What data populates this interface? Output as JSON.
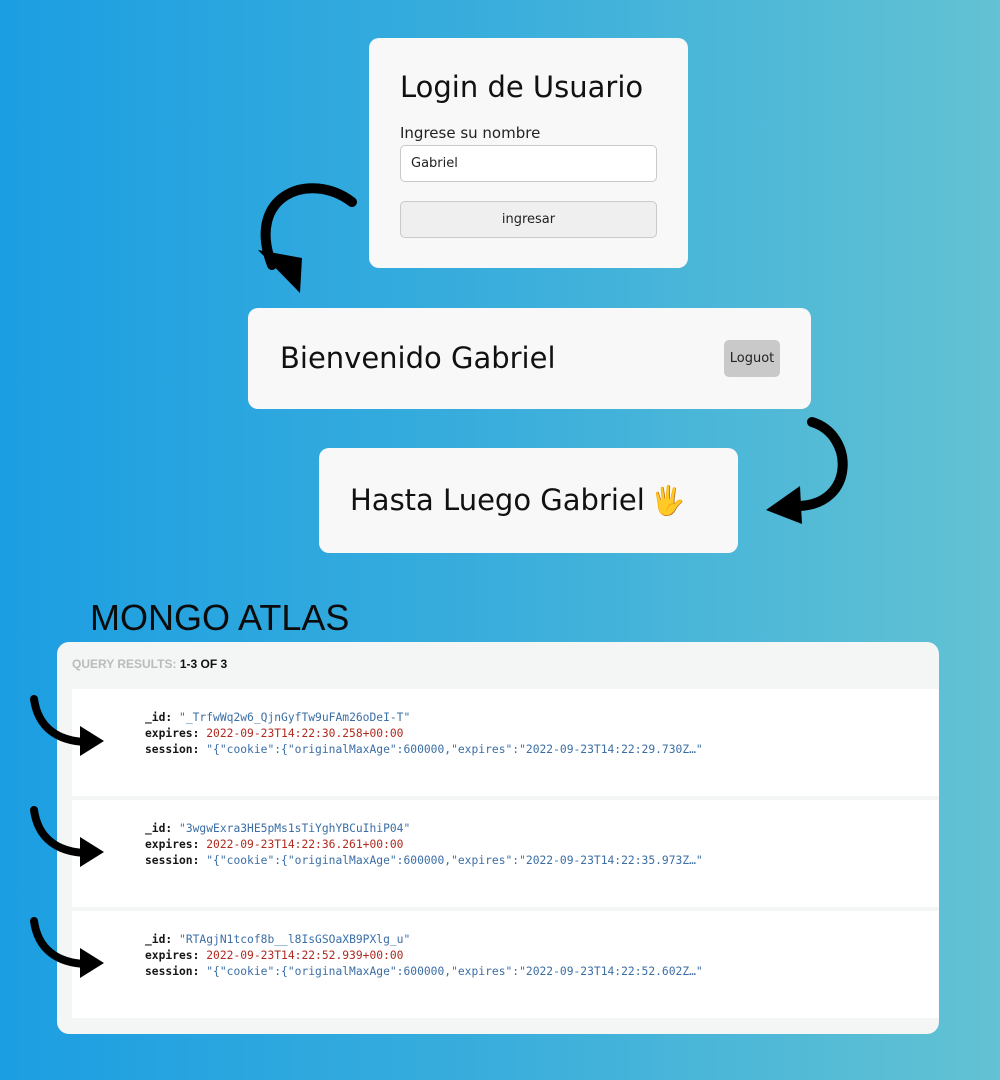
{
  "login": {
    "title": "Login de Usuario",
    "label": "Ingrese su nombre",
    "name_value": "Gabriel",
    "submit_label": "ingresar"
  },
  "welcome": {
    "text": "Bienvenido Gabriel",
    "logout_label": "Loguot"
  },
  "goodbye": {
    "text": "Hasta Luego Gabriel",
    "icon": "waving-hand-icon",
    "emoji": "🖐"
  },
  "mongo": {
    "title": "MONGO ATLAS",
    "results_label": "QUERY RESULTS:",
    "results_count": "1-3 OF 3",
    "field_labels": {
      "id": "_id:",
      "expires": "expires:",
      "session": "session:"
    },
    "documents": [
      {
        "id": "\"_TrfwWq2w6_QjnGyfTw9uFAm26oDeI-T\"",
        "expires": "2022-09-23T14:22:30.258+00:00",
        "session": "\"{\"cookie\":{\"originalMaxAge\":600000,\"expires\":\"2022-09-23T14:22:29.730Z…\""
      },
      {
        "id": "\"3wgwExra3HE5pMs1sTiYghYBCuIhiP04\"",
        "expires": "2022-09-23T14:22:36.261+00:00",
        "session": "\"{\"cookie\":{\"originalMaxAge\":600000,\"expires\":\"2022-09-23T14:22:35.973Z…\""
      },
      {
        "id": "\"RTAgjN1tcof8b__l8IsGSOaXB9PXlg_u\"",
        "expires": "2022-09-23T14:22:52.939+00:00",
        "session": "\"{\"cookie\":{\"originalMaxAge\":600000,\"expires\":\"2022-09-23T14:22:52.602Z…\""
      }
    ]
  },
  "colors": {
    "background_start": "#1c9ee2",
    "background_end": "#63c2d3",
    "card": "#f8f8f8",
    "string_value": "#3b6ea5",
    "date_value": "#b02a1f"
  }
}
